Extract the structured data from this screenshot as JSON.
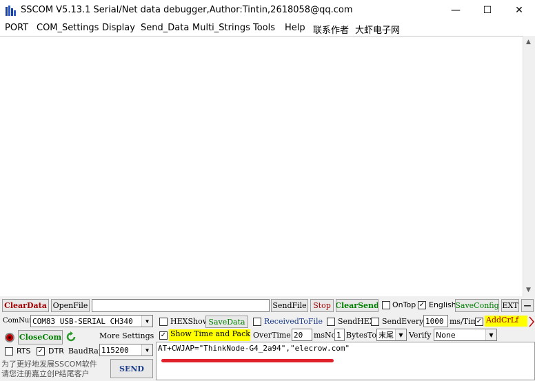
{
  "window": {
    "title": "SSCOM V5.13.1 Serial/Net data debugger,Author:Tintin,2618058@qq.com",
    "minimize_glyph": "—",
    "maximize_glyph": "☐",
    "close_glyph": "✕"
  },
  "menu": [
    "PORT",
    "COM_Settings",
    "Display",
    "Send_Data",
    "Multi_Strings",
    "Tools",
    "Help",
    "联系作者",
    "大虾电子网"
  ],
  "toolbar": {
    "clear_data": "ClearData",
    "open_file": "OpenFile",
    "file_path": "",
    "send_file": "SendFile",
    "stop": "Stop",
    "clear_send": "ClearSend",
    "on_top": "OnTop",
    "english": "English",
    "save_config": "SaveConfig",
    "ext": "EXT",
    "collapse": "—"
  },
  "port": {
    "com_num_label": "ComNum",
    "com_num_value": "COM83 USB-SERIAL CH340",
    "close_com": "CloseCom",
    "more_settings": "More Settings",
    "rts": "RTS",
    "dtr": "DTR",
    "baud_label": "BaudRat",
    "baud_value": "115200",
    "promo_line1": "为了更好地发展SSCOM软件",
    "promo_line2": "请您注册嘉立创P结尾客户",
    "send": "SEND"
  },
  "options": {
    "hex_show": "HEXShow",
    "save_data": "SaveData",
    "received_to_file": "ReceivedToFile",
    "send_hex": "SendHEX",
    "send_every": "SendEvery:",
    "send_every_value": "1000",
    "ms_tim": "ms/Tim",
    "add_crlf": "AddCrLf",
    "show_time": "Show Time and Packe",
    "over_time": "OverTime:",
    "over_time_value": "20",
    "ms": "ms",
    "no": "No",
    "no_value": "1",
    "bytes_to": "BytesTo",
    "bytes_to_value": "末尾",
    "verify": "Verify",
    "verify_value": "None"
  },
  "send_text": "AT+CWJAP=\"ThinkNode-G4_2a94\",\"elecrow.com\"",
  "colors": {
    "red_accent": "#a00000",
    "green_accent": "#008000",
    "yellow_highlight": "#ffff00",
    "annotation_red": "#e0202a"
  }
}
